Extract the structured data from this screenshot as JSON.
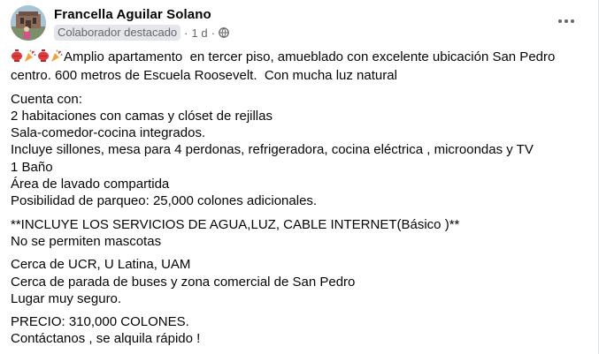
{
  "post": {
    "author": "Francella Aguilar Solano",
    "badge": "Colaborador destacado",
    "separator": "·",
    "time": "1 d",
    "privacy_icon": "globe-icon",
    "menu_icon": "more-options-icon",
    "emoji_sequence": [
      "red-lantern",
      "party-popper",
      "red-lantern",
      "party-popper"
    ],
    "paragraphs": [
      {
        "first_line_after_emojis": "Amplio apartamento  en tercer piso, amueblado con excelente ubicación San Pedro",
        "lines": [
          "centro. 600 metros de Escuela Roosevelt.  Con mucha luz natural"
        ]
      },
      {
        "lines": [
          "Cuenta con:",
          "2 habitaciones con camas y clóset de rejillas",
          "Sala-comedor-cocina integrados.",
          "Incluye sillones, mesa para 4 perdonas, refrigeradora, cocina eléctrica , microondas y TV",
          "1 Baño",
          "Área de lavado compartida",
          "Posibilidad de parqueo: 25,000 colones adicionales."
        ]
      },
      {
        "lines": [
          "**INCLUYE LOS SERVICIOS DE AGUA,LUZ, CABLE INTERNET(Básico )**",
          "No se permiten mascotas"
        ]
      },
      {
        "lines": [
          "Cerca de UCR, U Latina, UAM",
          "Cerca de parada de buses y zona comercial de San Pedro",
          "Lugar muy seguro."
        ]
      },
      {
        "lines": [
          "PRECIO: 310,000 COLONES.",
          "Contáctanos , se alquila rápido !"
        ]
      }
    ]
  }
}
